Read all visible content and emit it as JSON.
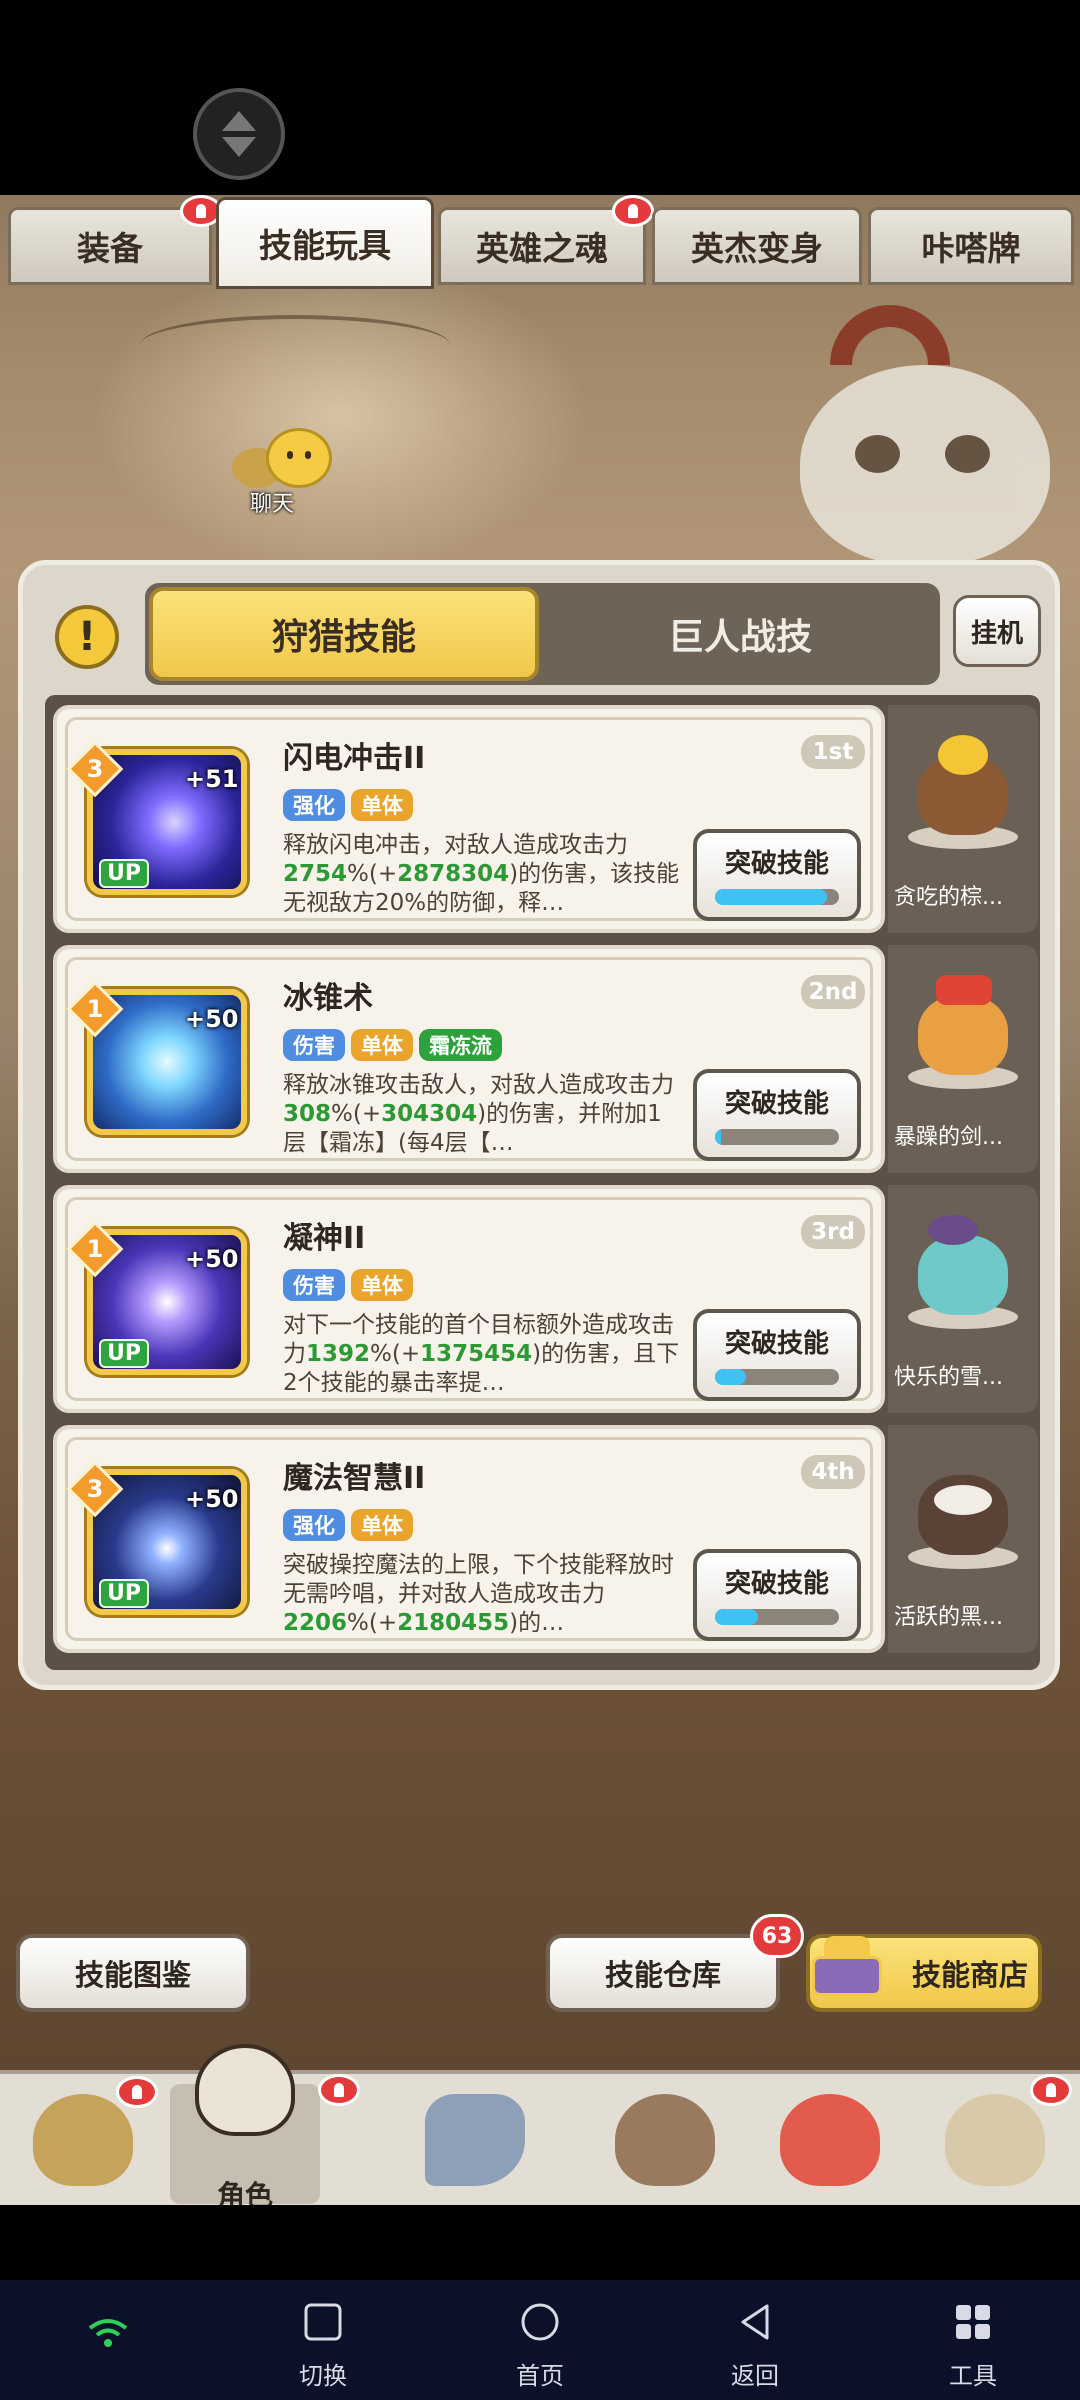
{
  "top_tabs": [
    {
      "label": "装备",
      "has_alert": true
    },
    {
      "label": "技能玩具",
      "has_alert": false,
      "active": true
    },
    {
      "label": "英雄之魂",
      "has_alert": true
    },
    {
      "label": "英杰变身",
      "has_alert": false
    },
    {
      "label": "咔嗒牌",
      "has_alert": false
    }
  ],
  "chat": {
    "label": "聊天"
  },
  "panel": {
    "segments": [
      {
        "label": "狩猎技能",
        "active": true
      },
      {
        "label": "巨人战技",
        "active": false
      }
    ],
    "hang_button": "挂机"
  },
  "skills": [
    {
      "name": "闪电冲击II",
      "rank": "1st",
      "level": "3",
      "plus": "+51",
      "up": "UP",
      "tags": [
        {
          "label": "强化",
          "color": "blue"
        },
        {
          "label": "单体",
          "color": "orange"
        }
      ],
      "desc_1": "释放闪电冲击，对敌人造成攻击力",
      "value_1": "2754",
      "desc_2": "%(+",
      "value_2": "2878304",
      "desc_3": ")的伤害，该技能无视敌方20%的防御，释…",
      "break_label": "突破技能",
      "progress": 0.9,
      "pet_name": "贪吃的棕..."
    },
    {
      "name": "冰锥术",
      "rank": "2nd",
      "level": "1",
      "plus": "+50",
      "up": "",
      "tags": [
        {
          "label": "伤害",
          "color": "blue"
        },
        {
          "label": "单体",
          "color": "orange"
        },
        {
          "label": "霜冻流",
          "color": "green"
        }
      ],
      "desc_1": "释放冰锥攻击敌人，对敌人造成攻击力",
      "value_1": "308",
      "desc_2": "%(+",
      "value_2": "304304",
      "desc_3": ")的伤害，并附加1层【霜冻】(每4层【…",
      "break_label": "突破技能",
      "progress": 0.05,
      "pet_name": "暴躁的剑..."
    },
    {
      "name": "凝神II",
      "rank": "3rd",
      "level": "1",
      "plus": "+50",
      "up": "UP",
      "tags": [
        {
          "label": "伤害",
          "color": "blue"
        },
        {
          "label": "单体",
          "color": "orange"
        }
      ],
      "desc_1": "对下一个技能的首个目标额外造成攻击力",
      "value_1": "1392",
      "desc_2": "%(+",
      "value_2": "1375454",
      "desc_3": ")的伤害，且下2个技能的暴击率提…",
      "break_label": "突破技能",
      "progress": 0.25,
      "pet_name": "快乐的雪..."
    },
    {
      "name": "魔法智慧II",
      "rank": "4th",
      "level": "3",
      "plus": "+50",
      "up": "UP",
      "tags": [
        {
          "label": "强化",
          "color": "blue"
        },
        {
          "label": "单体",
          "color": "orange"
        }
      ],
      "desc_1": "突破操控魔法的上限，下个技能释放时无需吟唱，并对敌人造成攻击力",
      "value_1": "2206",
      "desc_2": "%(+",
      "value_2": "2180455",
      "desc_3": ")的…",
      "break_label": "突破技能",
      "progress": 0.35,
      "pet_name": "活跃的黑..."
    }
  ],
  "bottom_buttons": {
    "codex": "技能图鉴",
    "storage": "技能仓库",
    "storage_badge": "63",
    "shop": "技能商店"
  },
  "game_nav": {
    "active_label": "角色"
  },
  "android_nav": [
    {
      "label": "切换",
      "icon": "square-icon"
    },
    {
      "label": "首页",
      "icon": "circle-icon"
    },
    {
      "label": "返回",
      "icon": "back-triangle-icon"
    },
    {
      "label": "工具",
      "icon": "grid-icon"
    }
  ]
}
